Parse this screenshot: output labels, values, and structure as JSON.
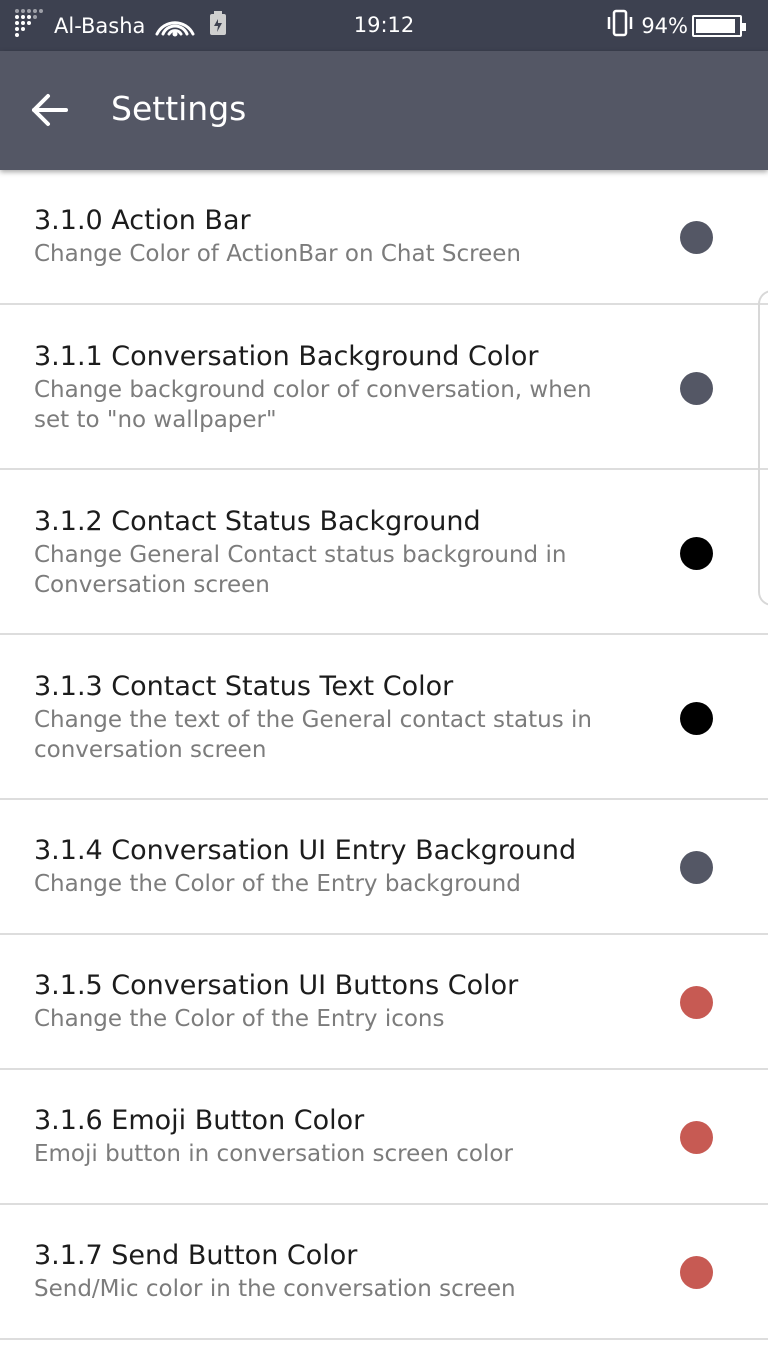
{
  "status_bar": {
    "carrier": "Al-Basha",
    "time": "19:12",
    "battery_percent_label": "94%",
    "battery_level": 0.94,
    "icons": [
      "signal-icon",
      "wifi-icon",
      "battery-saver-icon",
      "vibrate-icon",
      "battery-icon"
    ]
  },
  "app_bar": {
    "title": "Settings",
    "back_icon": "arrow-back-icon",
    "background_color": "#545765"
  },
  "settings": [
    {
      "title": "3.1.0 Action Bar",
      "summary": "Change Color of ActionBar on Chat Screen",
      "color": "#545765"
    },
    {
      "title": "3.1.1 Conversation Background Color",
      "summary": "Change background color of conversation, when set to \"no wallpaper\"",
      "color": "#545765"
    },
    {
      "title": "3.1.2 Contact Status Background",
      "summary": "Change General Contact status background in Conversation screen",
      "color": "#000000"
    },
    {
      "title": "3.1.3 Contact Status Text Color",
      "summary": "Change the text of the General contact status in conversation screen",
      "color": "#000000"
    },
    {
      "title": "3.1.4 Conversation UI Entry Background",
      "summary": "Change the Color of the Entry background",
      "color": "#545765"
    },
    {
      "title": "3.1.5 Conversation UI Buttons Color",
      "summary": "Change the Color of the Entry icons",
      "color": "#c75a53"
    },
    {
      "title": "3.1.6 Emoji Button Color",
      "summary": "Emoji button in conversation screen color",
      "color": "#c75a53"
    },
    {
      "title": "3.1.7 Send Button Color",
      "summary": "Send/Mic color in the conversation screen",
      "color": "#c75a53"
    }
  ]
}
